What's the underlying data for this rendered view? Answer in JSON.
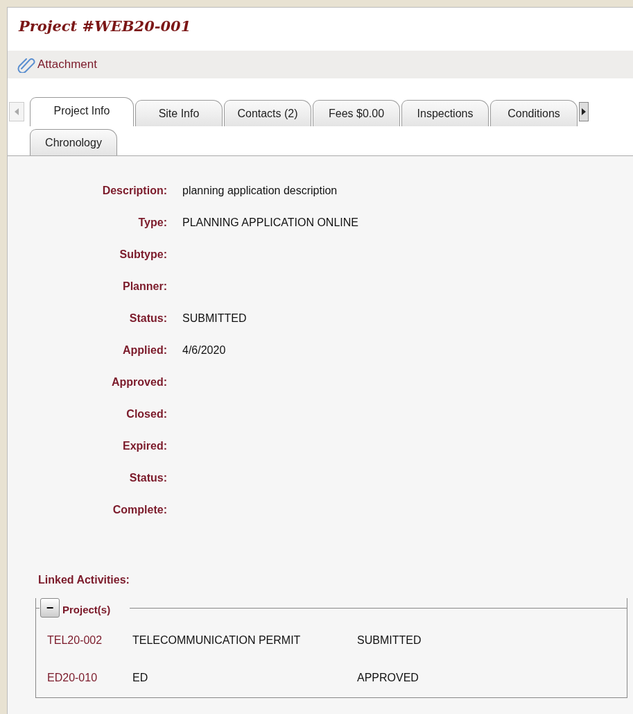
{
  "title": "Project #WEB20-001",
  "attachment": {
    "label": "Attachment"
  },
  "tabs": [
    {
      "label": "Project Info",
      "selected": true
    },
    {
      "label": "Site Info",
      "selected": false
    },
    {
      "label": "Contacts (2)",
      "selected": false
    },
    {
      "label": "Fees $0.00",
      "selected": false
    },
    {
      "label": "Inspections",
      "selected": false
    },
    {
      "label": "Conditions",
      "selected": false
    },
    {
      "label": "Chronology",
      "selected": false
    }
  ],
  "fields": [
    {
      "label": "Description:",
      "value": "planning application description"
    },
    {
      "label": "Type:",
      "value": "PLANNING APPLICATION ONLINE"
    },
    {
      "label": "Subtype:"
    },
    {
      "label": "Planner:"
    },
    {
      "label": "Status:",
      "value": "SUBMITTED"
    },
    {
      "label": "Applied:",
      "value": "4/6/2020"
    },
    {
      "label": "Approved:"
    },
    {
      "label": "Closed:"
    },
    {
      "label": "Expired:"
    },
    {
      "label": "Status:"
    },
    {
      "label": "Complete:"
    }
  ],
  "linked": {
    "heading": "Linked Activities:",
    "group": {
      "toggle": "−",
      "legend": "Project(s)",
      "expanded": true,
      "rows": [
        {
          "number": "TEL20-002",
          "type": "TELECOMMUNICATION PERMIT",
          "status": "SUBMITTED"
        },
        {
          "number": "ED20-010",
          "type": "ED",
          "status": "APPROVED"
        }
      ]
    }
  }
}
